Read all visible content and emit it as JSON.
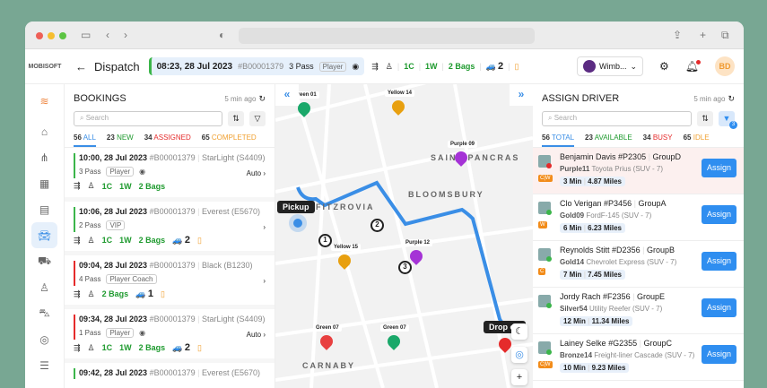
{
  "header": {
    "brand": "MOBISOFT",
    "title": "Dispatch",
    "current": {
      "time": "08:23, 28 Jul 2023",
      "id": "#B00001379",
      "pass": "3 Pass",
      "tag": "Player",
      "c": "1C",
      "w": "1W",
      "bags": "2 Bags",
      "cars": "2"
    },
    "venue": "Wimb...",
    "user_initials": "BD"
  },
  "bookings": {
    "title": "BOOKINGS",
    "updated": "5 min ago",
    "search_placeholder": "Search",
    "tabs": [
      {
        "n": "56",
        "l": "ALL",
        "c": "#3a8ee6"
      },
      {
        "n": "23",
        "l": "NEW",
        "c": "#1e9a2e"
      },
      {
        "n": "34",
        "l": "ASSIGNED",
        "c": "#e52b2b"
      },
      {
        "n": "65",
        "l": "COMPLETED",
        "c": "#f0a030"
      }
    ],
    "items": [
      {
        "time": "10:00, 28 Jul 2023",
        "id": "#B00001379",
        "vehicle": "StarLight (S4409)",
        "pass": "3 Pass",
        "tag": "Player",
        "mode": "Auto",
        "c": "1C",
        "w": "1W",
        "bags": "2 Bags",
        "cars": "",
        "status": "#3bb54a"
      },
      {
        "time": "10:06, 28 Jul 2023",
        "id": "#B00001379",
        "vehicle": "Everest (E5670)",
        "pass": "2 Pass",
        "tag": "VIP",
        "mode": "",
        "c": "1C",
        "w": "1W",
        "bags": "2 Bags",
        "cars": "2",
        "status": "#3bb54a"
      },
      {
        "time": "09:04, 28 Jul 2023",
        "id": "#B00001379",
        "vehicle": "Black (B1230)",
        "pass": "4 Pass",
        "tag": "Player Coach",
        "mode": "",
        "c": "",
        "w": "",
        "bags": "2 Bags",
        "cars": "1",
        "status": "#e52b2b"
      },
      {
        "time": "09:34, 28 Jul 2023",
        "id": "#B00001379",
        "vehicle": "StarLight (S4409)",
        "pass": "1 Pass",
        "tag": "Player",
        "mode": "Auto",
        "c": "1C",
        "w": "1W",
        "bags": "2 Bags",
        "cars": "2",
        "status": "#e52b2b"
      },
      {
        "time": "09:42, 28 Jul 2023",
        "id": "#B00001379",
        "vehicle": "Everest (E5670)",
        "pass": "",
        "tag": "",
        "mode": "",
        "c": "",
        "w": "",
        "bags": "",
        "cars": "",
        "status": "#3bb54a"
      }
    ]
  },
  "map": {
    "areas": [
      "SAINT PANCRAS",
      "BLOOMSBURY",
      "FITZROVIA",
      "CARNABY"
    ],
    "vehicles": [
      {
        "name": "Green 01",
        "color": "#1aa86a"
      },
      {
        "name": "Yellow 14",
        "color": "#e8a010"
      },
      {
        "name": "Purple 09",
        "color": "#a533d6"
      },
      {
        "name": "Purple 12",
        "color": "#a533d6"
      },
      {
        "name": "Yellow 15",
        "color": "#e8a010"
      },
      {
        "name": "Green 07",
        "color": "#e84040"
      },
      {
        "name": "Green 07",
        "color": "#1aa86a"
      }
    ],
    "pickup": "Pickup",
    "dropoff": "Drop off",
    "stops": [
      "1",
      "2",
      "3"
    ]
  },
  "drivers": {
    "title": "ASSIGN DRIVER",
    "updated": "5 min ago",
    "search_placeholder": "Search",
    "filter_count": "3",
    "tabs": [
      {
        "n": "56",
        "l": "TOTAL",
        "c": "#3a8ee6"
      },
      {
        "n": "23",
        "l": "AVAILABLE",
        "c": "#1e9a2e"
      },
      {
        "n": "34",
        "l": "BUSY",
        "c": "#e52b2b"
      },
      {
        "n": "65",
        "l": "IDLE",
        "c": "#f0a030"
      }
    ],
    "assign_label": "Assign",
    "items": [
      {
        "name": "Benjamin Davis",
        "code": "#P2305",
        "group": "GroupD",
        "car": "Purple11",
        "model": "Toyota Prius (SUV - 7)",
        "time": "3 Min",
        "dist": "4.87 Miles",
        "badge": "C|W",
        "status": "#e52b2b"
      },
      {
        "name": "Clo Verigan",
        "code": "#P3456",
        "group": "GroupA",
        "car": "Gold09",
        "model": "FordF-145 (SUV - 7)",
        "time": "6 Min",
        "dist": "6.23 Miles",
        "badge": "W",
        "status": "#3bb54a"
      },
      {
        "name": "Reynolds Stitt",
        "code": "#D2356",
        "group": "GroupB",
        "car": "Gold14",
        "model": "Chevrolet Express (SUV - 7)",
        "time": "7 Min",
        "dist": "7.45 Miles",
        "badge": "C",
        "status": "#3bb54a"
      },
      {
        "name": "Jordy Rach",
        "code": "#F2356",
        "group": "GroupE",
        "car": "Silver54",
        "model": "Utility Reefer (SUV - 7)",
        "time": "12 Min",
        "dist": "11.34 Miles",
        "badge": "",
        "status": "#3bb54a"
      },
      {
        "name": "Lainey Selke",
        "code": "#G2355",
        "group": "GroupC",
        "car": "Bronze14",
        "model": "Freight-liner Cascade (SUV - 7)",
        "time": "10 Min",
        "dist": "9.23 Miles",
        "badge": "C|W",
        "status": "#3bb54a"
      }
    ]
  }
}
